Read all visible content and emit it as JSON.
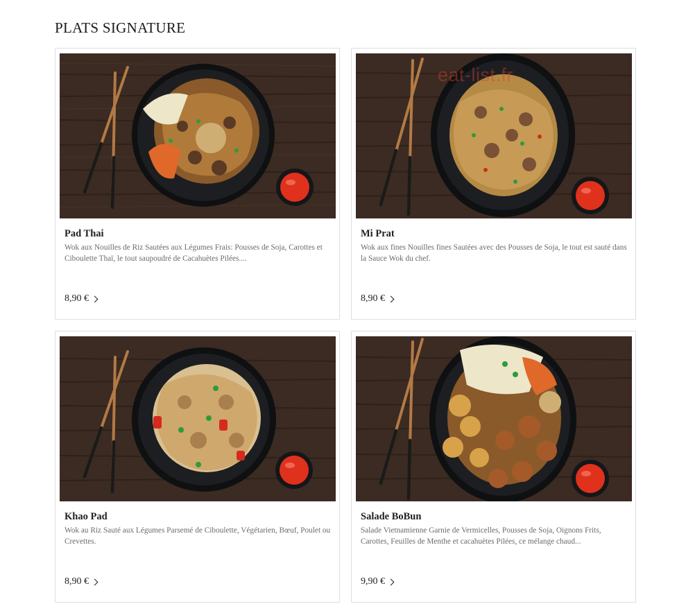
{
  "section": {
    "title": "PLATS SIGNATURE"
  },
  "watermark": "eat-list.fr",
  "dishes": [
    {
      "name": "Pad Thai",
      "description": "Wok aux Nouilles de Riz Sautées aux Légumes Frais: Pousses de Soja, Carottes et Ciboulette Thaï, le tout saupoudré de Cacahuètes Pilées....",
      "price": "8,90 €"
    },
    {
      "name": "Mi Prat",
      "description": "Wok aux fines Nouilles fines Sautées avec des Pousses de Soja, le tout est sauté dans la Sauce Wok du chef.",
      "price": "8,90 €"
    },
    {
      "name": "Khao Pad",
      "description": "Wok au Riz Sauté aux Légumes Parsemé de Ciboulette, Végétarien, Bœuf, Poulet ou Crevettes.",
      "price": "8,90 €"
    },
    {
      "name": "Salade BoBun",
      "description": "Salade Vietnamienne Garnie de Vermicelles, Pousses de Soja, Oignons Frits, Carottes, Feuilles de Menthe et cacahuètes Pilées, ce mélange chaud...",
      "price": "9,90 €"
    }
  ],
  "colors": {
    "wood": "#3b2b22",
    "bowl": "#17181b",
    "sauce": "#e0311d",
    "border": "#dedede"
  },
  "icons": {
    "price_arrow": "chevron-right-icon"
  }
}
